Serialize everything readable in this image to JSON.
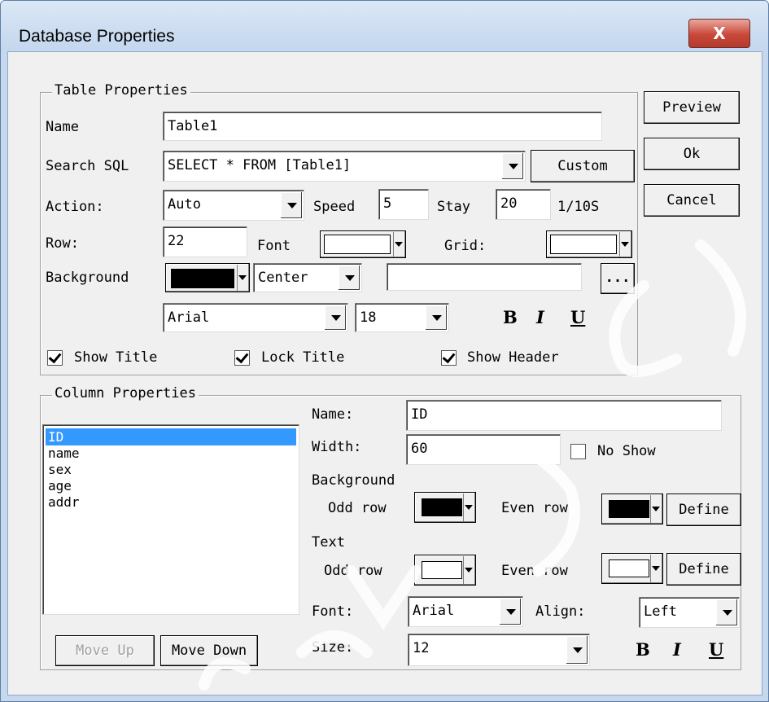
{
  "window": {
    "title": "Database Properties",
    "close_label": "X"
  },
  "side_buttons": {
    "preview": "Preview",
    "ok": "Ok",
    "cancel": "Cancel"
  },
  "table_props": {
    "legend": "Table Properties",
    "name_label": "Name",
    "name_value": "Table1",
    "sql_label": "Search SQL",
    "sql_value": "SELECT * FROM [Table1]",
    "custom_button": "Custom",
    "action_label": "Action:",
    "action_value": "Auto",
    "speed_label": "Speed",
    "speed_value": "5",
    "stay_label": "Stay",
    "stay_value": "20",
    "stay_unit": "1/10S",
    "row_label": "Row:",
    "row_value": "22",
    "font_label": "Font",
    "grid_label": "Grid:",
    "background_label": "Background",
    "align_value": "Center",
    "image_path_value": "",
    "browse_button": "...",
    "font_family_value": "Arial",
    "font_size_value": "18",
    "bold_label": "B",
    "italic_label": "I",
    "underline_label": "U",
    "show_title_label": "Show Title",
    "lock_title_label": "Lock Title",
    "show_header_label": "Show Header",
    "show_title_checked": true,
    "lock_title_checked": true,
    "show_header_checked": true,
    "colors": {
      "font": "#ffffff",
      "grid": "#ffffff",
      "background": "#000000"
    }
  },
  "column_props": {
    "legend": "Column Properties",
    "columns": [
      "ID",
      "name",
      "sex",
      "age",
      "addr"
    ],
    "selected_column": "ID",
    "move_up_button": "Move Up",
    "move_down_button": "Move Down",
    "name_label": "Name:",
    "name_value": "ID",
    "width_label": "Width:",
    "width_value": "60",
    "no_show_label": "No Show",
    "no_show_checked": false,
    "background_label": "Background",
    "odd_row_label": "Odd row",
    "even_row_label": "Even row",
    "define_button": "Define",
    "text_label": "Text",
    "font_label": "Font:",
    "font_value": "Arial",
    "align_label": "Align:",
    "align_value": "Left",
    "size_label": "Size:",
    "size_value": "12",
    "bold_label": "B",
    "italic_label": "I",
    "underline_label": "U",
    "colors": {
      "bg_odd": "#000000",
      "bg_even": "#000000",
      "text_odd": "#ffffff",
      "text_even": "#ffffff"
    }
  },
  "accent_color": "#3399ff"
}
